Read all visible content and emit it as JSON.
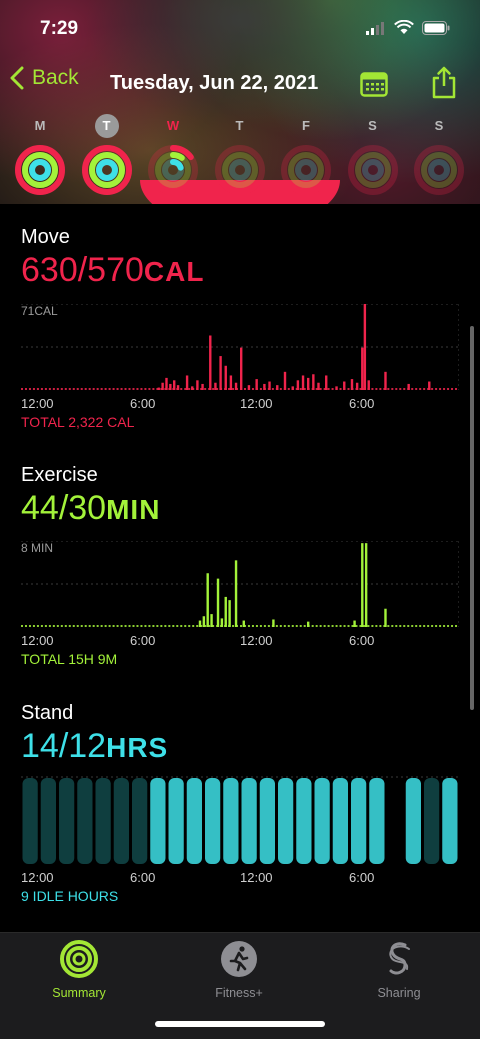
{
  "status": {
    "time": "7:29"
  },
  "nav": {
    "back_label": "Back",
    "title": "Tuesday, Jun 22, 2021"
  },
  "week": {
    "days": [
      {
        "letter": "M",
        "move": 1.0,
        "exercise": 1.0,
        "stand": 1.0
      },
      {
        "letter": "T",
        "move": 1.0,
        "exercise": 1.0,
        "stand": 1.0
      },
      {
        "letter": "W",
        "move": 0.15,
        "exercise": 0.1,
        "stand": 0.2
      },
      {
        "letter": "T",
        "move": 0,
        "exercise": 0,
        "stand": 0
      },
      {
        "letter": "F",
        "move": 0,
        "exercise": 0,
        "stand": 0
      },
      {
        "letter": "S",
        "move": 0,
        "exercise": 0,
        "stand": 0
      },
      {
        "letter": "S",
        "move": 0,
        "exercise": 0,
        "stand": 0
      }
    ],
    "selected_index": 1,
    "today_index": 2
  },
  "colors": {
    "move": "#f0244c",
    "exercise": "#a3f23a",
    "stand": "#3ee0e8",
    "accent": "#a3e635",
    "stand_dim": "#0f3e3f"
  },
  "move": {
    "title": "Move",
    "value": "630/570",
    "unit": "CAL",
    "scale_label": "71CAL",
    "axis": [
      "12:00",
      "6:00",
      "12:00",
      "6:00"
    ],
    "total": "TOTAL 2,322 CAL"
  },
  "exercise": {
    "title": "Exercise",
    "value": "44/30",
    "unit": "MIN",
    "scale_label": "8 MIN",
    "axis": [
      "12:00",
      "6:00",
      "12:00",
      "6:00"
    ],
    "total": "TOTAL 15H 9M"
  },
  "stand": {
    "title": "Stand",
    "value": "14/12",
    "unit": "HRS",
    "axis": [
      "12:00",
      "6:00",
      "12:00",
      "6:00"
    ],
    "total": "9 IDLE HOURS"
  },
  "tabs": [
    {
      "label": "Summary",
      "active": true,
      "icon": "activity-rings-icon"
    },
    {
      "label": "Fitness+",
      "active": false,
      "icon": "running-figure-icon"
    },
    {
      "label": "Sharing",
      "active": false,
      "icon": "sharing-icon"
    }
  ],
  "chart_data": [
    {
      "type": "bar",
      "title": "Move",
      "ylabel": "71CAL",
      "x_tick_labels": [
        "12:00",
        "6:00",
        "12:00",
        "6:00"
      ],
      "ylim": [
        0,
        71
      ],
      "values": [
        1,
        1,
        1,
        1,
        1,
        1,
        1,
        1,
        1,
        1,
        1,
        1,
        1,
        1,
        1,
        1,
        1,
        1,
        1,
        1,
        1,
        1,
        1,
        1,
        1,
        1,
        1,
        1,
        1,
        1,
        1,
        1,
        1,
        1,
        1,
        1,
        1,
        1,
        1,
        1,
        1,
        1,
        1,
        1,
        1,
        1,
        1,
        1,
        1,
        1,
        1,
        1,
        1,
        1,
        1,
        1,
        1,
        1,
        1,
        1,
        1,
        1,
        1,
        1,
        1,
        1,
        1,
        1,
        1,
        1,
        1,
        1,
        1,
        1,
        1,
        1,
        1,
        1,
        1,
        1,
        1,
        1,
        1,
        1,
        1,
        1,
        1,
        1,
        1,
        1,
        1,
        1,
        1,
        1,
        1,
        1,
        1,
        1,
        1,
        1,
        1,
        1,
        1,
        1,
        1,
        1,
        1,
        1,
        1,
        1,
        1,
        1,
        1,
        1,
        1,
        1,
        1,
        1,
        1,
        1,
        1,
        1,
        1,
        1,
        1,
        1,
        1,
        1,
        1,
        1,
        1,
        1,
        1,
        1,
        1,
        1,
        1,
        1,
        1,
        1,
        1,
        1,
        1,
        1,
        1,
        1,
        1,
        1,
        1,
        1,
        1,
        1,
        1,
        1,
        1,
        1,
        1,
        1,
        1,
        1,
        1,
        1,
        1,
        1,
        1,
        1,
        1,
        1,
        1,
        1,
        1,
        1,
        1,
        1,
        1,
        1,
        1,
        1,
        1,
        1,
        1,
        1,
        1,
        1,
        1,
        1,
        1,
        1,
        1,
        1,
        1,
        1,
        1,
        1,
        1,
        1,
        1,
        1,
        1,
        1,
        1,
        1,
        1,
        1,
        1,
        1,
        1,
        1,
        1,
        1,
        1,
        1,
        1,
        1,
        1,
        1,
        1,
        1,
        1,
        1,
        1,
        1,
        1,
        1,
        1,
        1,
        1,
        1,
        1,
        1,
        1,
        1,
        1,
        1,
        1,
        1,
        1,
        1,
        1,
        1,
        1,
        1,
        1,
        1,
        1,
        1,
        1,
        1,
        1,
        1,
        1,
        1,
        1,
        1,
        1,
        1,
        1,
        1,
        1,
        1,
        1,
        1,
        1,
        1,
        1,
        1,
        1,
        1,
        1,
        1,
        1,
        1
      ],
      "peaks": [
        {
          "hour": 10.6,
          "value": 2
        },
        {
          "hour": 10.9,
          "value": 6
        },
        {
          "hour": 11.2,
          "value": 10
        },
        {
          "hour": 11.5,
          "value": 5
        },
        {
          "hour": 11.8,
          "value": 8
        },
        {
          "hour": 12.1,
          "value": 4
        },
        {
          "hour": 12.8,
          "value": 12
        },
        {
          "hour": 13.2,
          "value": 3
        },
        {
          "hour": 13.6,
          "value": 8
        },
        {
          "hour": 14.0,
          "value": 5
        },
        {
          "hour": 14.6,
          "value": 45
        },
        {
          "hour": 15.0,
          "value": 6
        },
        {
          "hour": 15.4,
          "value": 28
        },
        {
          "hour": 15.8,
          "value": 20
        },
        {
          "hour": 16.2,
          "value": 12
        },
        {
          "hour": 16.6,
          "value": 6
        },
        {
          "hour": 17.0,
          "value": 35
        },
        {
          "hour": 17.6,
          "value": 4
        },
        {
          "hour": 18.2,
          "value": 9
        },
        {
          "hour": 18.8,
          "value": 5
        },
        {
          "hour": 19.2,
          "value": 7
        },
        {
          "hour": 19.8,
          "value": 4
        },
        {
          "hour": 20.4,
          "value": 15
        },
        {
          "hour": 21.0,
          "value": 3
        },
        {
          "hour": 21.4,
          "value": 8
        },
        {
          "hour": 21.8,
          "value": 12
        },
        {
          "hour": 22.2,
          "value": 10
        },
        {
          "hour": 22.6,
          "value": 13
        },
        {
          "hour": 23.0,
          "value": 6
        },
        {
          "hour": 23.6,
          "value": 12
        },
        {
          "hour": 24.4,
          "value": 3
        },
        {
          "hour": 25.0,
          "value": 7
        },
        {
          "hour": 25.6,
          "value": 9
        },
        {
          "hour": 26.0,
          "value": 6
        },
        {
          "hour": 26.4,
          "value": 35
        },
        {
          "hour": 26.6,
          "value": 71
        },
        {
          "hour": 26.9,
          "value": 8
        },
        {
          "hour": 28.2,
          "value": 15
        },
        {
          "hour": 30.0,
          "value": 5
        },
        {
          "hour": 31.6,
          "value": 7
        }
      ]
    },
    {
      "type": "bar",
      "title": "Exercise",
      "ylabel": "8 MIN",
      "x_tick_labels": [
        "12:00",
        "6:00",
        "12:00",
        "6:00"
      ],
      "ylim": [
        0,
        8
      ],
      "peaks": [
        {
          "hour": 13.8,
          "value": 0.6
        },
        {
          "hour": 14.1,
          "value": 1.0
        },
        {
          "hour": 14.4,
          "value": 5.0
        },
        {
          "hour": 14.7,
          "value": 1.2
        },
        {
          "hour": 15.2,
          "value": 4.5
        },
        {
          "hour": 15.5,
          "value": 0.8
        },
        {
          "hour": 15.8,
          "value": 2.8
        },
        {
          "hour": 16.1,
          "value": 2.5
        },
        {
          "hour": 16.6,
          "value": 6.2
        },
        {
          "hour": 17.2,
          "value": 0.6
        },
        {
          "hour": 19.5,
          "value": 0.7
        },
        {
          "hour": 22.2,
          "value": 0.5
        },
        {
          "hour": 25.8,
          "value": 0.6
        },
        {
          "hour": 26.4,
          "value": 7.8
        },
        {
          "hour": 26.7,
          "value": 7.8
        },
        {
          "hour": 28.2,
          "value": 1.7
        }
      ]
    },
    {
      "type": "bar",
      "title": "Stand",
      "ylabel": "",
      "x_tick_labels": [
        "12:00",
        "6:00",
        "12:00",
        "6:00"
      ],
      "stood_hours": [
        0,
        0,
        0,
        0,
        0,
        0,
        0,
        1,
        1,
        1,
        1,
        1,
        1,
        1,
        1,
        1,
        1,
        1,
        1,
        1,
        1,
        1,
        0,
        1,
        0,
        0,
        0
      ],
      "slots": 24
    }
  ]
}
